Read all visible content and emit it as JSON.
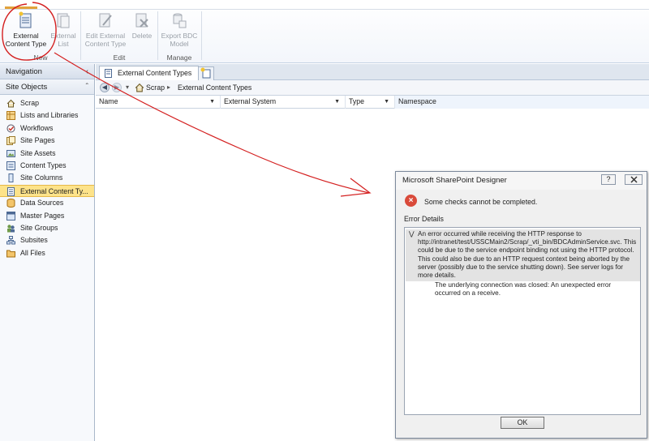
{
  "ribbon": {
    "buttons": [
      {
        "label_line1": "External",
        "label_line2": "Content Type",
        "icon": "external-content-type-icon",
        "enabled": true
      },
      {
        "label_line1": "External",
        "label_line2": "List",
        "icon": "external-list-icon",
        "enabled": false
      },
      {
        "label_line1": "Edit External",
        "label_line2": "Content Type",
        "icon": "edit-icon",
        "enabled": false
      },
      {
        "label_line1": "Delete",
        "label_line2": "",
        "icon": "delete-icon",
        "enabled": false
      },
      {
        "label_line1": "Export BDC",
        "label_line2": "Model",
        "icon": "export-model-icon",
        "enabled": false
      }
    ],
    "groups": [
      "New",
      "Edit",
      "Manage"
    ]
  },
  "navigation": {
    "header": "Navigation",
    "section": "Site Objects",
    "items": [
      {
        "label": "Scrap",
        "icon": "home-icon"
      },
      {
        "label": "Lists and Libraries",
        "icon": "list-icon"
      },
      {
        "label": "Workflows",
        "icon": "workflow-icon"
      },
      {
        "label": "Site Pages",
        "icon": "pages-icon"
      },
      {
        "label": "Site Assets",
        "icon": "assets-icon"
      },
      {
        "label": "Content Types",
        "icon": "content-types-icon"
      },
      {
        "label": "Site Columns",
        "icon": "columns-icon"
      },
      {
        "label": "External Content Ty...",
        "icon": "external-content-type-icon",
        "selected": true
      },
      {
        "label": "Data Sources",
        "icon": "database-icon"
      },
      {
        "label": "Master Pages",
        "icon": "master-pages-icon"
      },
      {
        "label": "Site Groups",
        "icon": "groups-icon"
      },
      {
        "label": "Subsites",
        "icon": "subsites-icon"
      },
      {
        "label": "All Files",
        "icon": "folder-icon"
      }
    ]
  },
  "main": {
    "tab_label": "External Content Types",
    "breadcrumb": [
      "Scrap",
      "External Content Types"
    ],
    "columns": [
      "Name",
      "External System",
      "Type",
      "Namespace"
    ]
  },
  "dialog": {
    "title": "Microsoft SharePoint Designer",
    "help": "?",
    "message": "Some checks cannot be completed.",
    "details_label": "Error Details",
    "detail_main": "An error occurred while receiving the HTTP response to http://intranet/test/USSCMain2/Scrap/_vti_bin/BDCAdminService.svc. This could be due to the service endpoint binding not using the HTTP protocol. This could also be due to an HTTP request context being aborted by the server (possibly due to the service shutting down). See server logs for more details.",
    "detail_inner": "The underlying connection was closed: An unexpected error occurred on a receive.",
    "ok_label": "OK"
  },
  "colors": {
    "annotation": "#d42020",
    "selected_nav": "#fde38a",
    "error_icon": "#d94a3a"
  }
}
